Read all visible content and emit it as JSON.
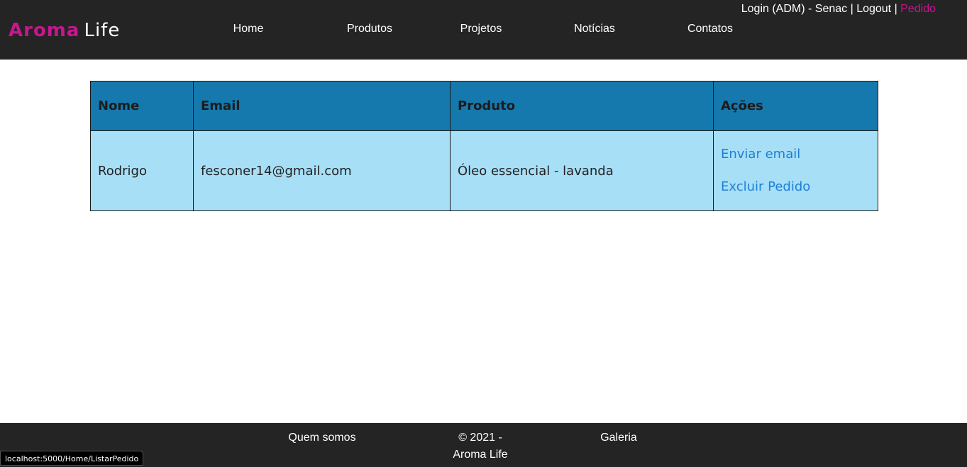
{
  "header": {
    "logo": {
      "brand": "Aroma",
      "rest": "Life"
    },
    "nav": [
      "Home",
      "Produtos",
      "Projetos",
      "Notícias",
      "Contatos"
    ],
    "user": {
      "login_text": "Login (ADM) - Senac",
      "sep1": " | ",
      "logout": "Logout",
      "sep2": " | ",
      "pedido": "Pedido"
    }
  },
  "table": {
    "headers": [
      "Nome",
      "Email",
      "Produto",
      "Ações"
    ],
    "rows": [
      {
        "nome": "Rodrigo",
        "email": "fesconer14@gmail.com",
        "produto": "Óleo essencial - lavanda",
        "acoes": [
          "Enviar email",
          "Excluir Pedido"
        ]
      }
    ]
  },
  "footer": {
    "quem_somos": "Quem somos",
    "copyright_line1": "© 2021 -",
    "copyright_line2": "Aroma Life",
    "galeria": "Galeria"
  },
  "statusbar": {
    "url": "localhost:5000/Home/ListarPedido"
  },
  "colors": {
    "header_bg": "#242424",
    "brand_accent": "#c8168f",
    "table_header_bg": "#1579ad",
    "table_row_bg": "#a7dff7",
    "link": "#1e7fd6"
  }
}
